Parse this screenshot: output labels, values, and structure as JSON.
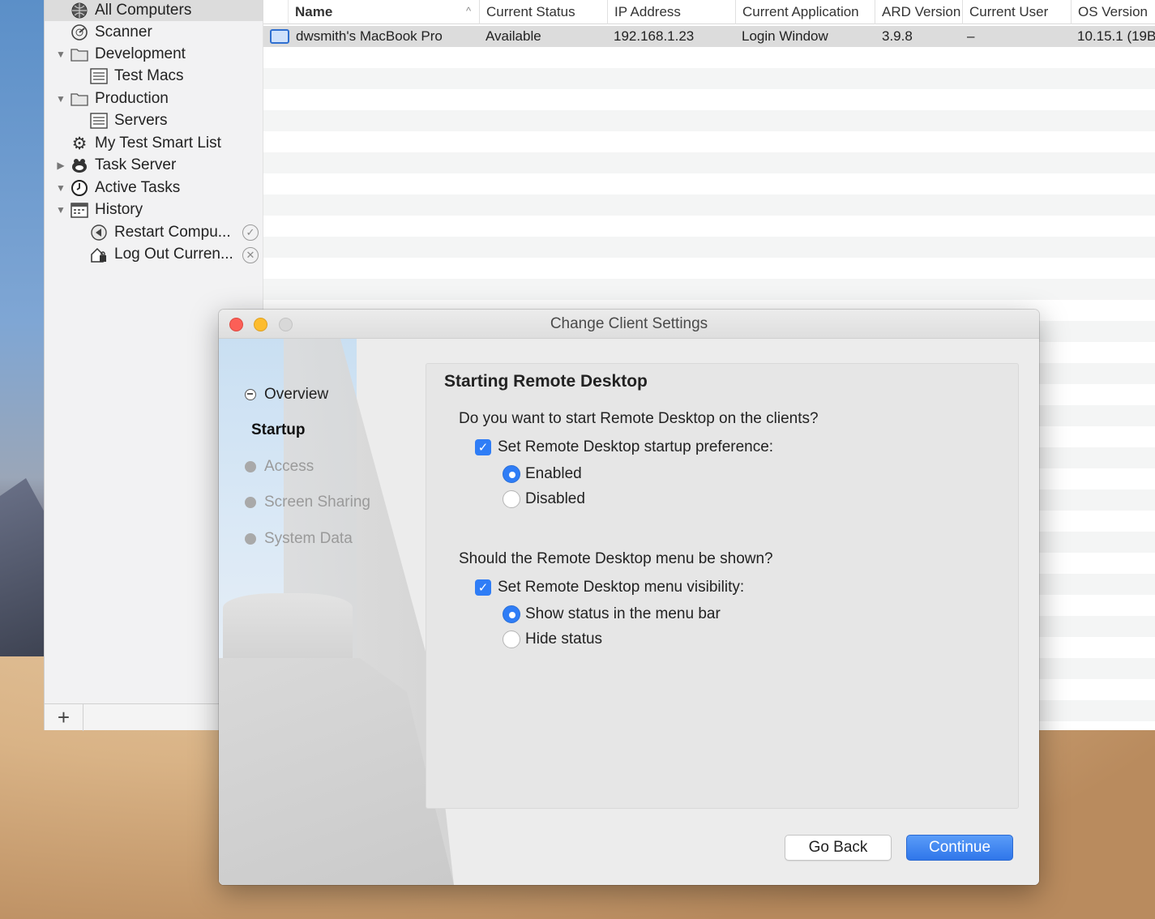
{
  "sidebar": {
    "items": [
      {
        "label": "All Computers",
        "icon": "globe-network-icon"
      },
      {
        "label": "Scanner",
        "icon": "scanner-icon"
      },
      {
        "label": "Development",
        "icon": "folder-icon"
      },
      {
        "label": "Test Macs",
        "icon": "list-icon"
      },
      {
        "label": "Production",
        "icon": "folder-icon"
      },
      {
        "label": "Servers",
        "icon": "list-icon"
      },
      {
        "label": "My Test Smart List",
        "icon": "gear-icon"
      },
      {
        "label": "Task Server",
        "icon": "task-server-icon"
      },
      {
        "label": "Active Tasks",
        "icon": "clock-icon"
      },
      {
        "label": "History",
        "icon": "calendar-icon"
      },
      {
        "label": "Restart Compu...",
        "icon": "restart-icon"
      },
      {
        "label": "Log Out Curren...",
        "icon": "logout-icon"
      }
    ],
    "add_label": "+"
  },
  "table": {
    "columns": [
      "Name",
      "Current Status",
      "IP Address",
      "Current Application",
      "ARD Version",
      "Current User",
      "OS Version"
    ],
    "rows": [
      {
        "name": "dwsmith's MacBook Pro",
        "status": "Available",
        "ip": "192.168.1.23",
        "application": "Login Window",
        "ard_version": "3.9.8",
        "user": "–",
        "os_version": "10.15.1 (19B"
      }
    ]
  },
  "dialog": {
    "title": "Change Client Settings",
    "steps": [
      "Overview",
      "Startup",
      "Access",
      "Screen Sharing",
      "System Data"
    ],
    "panel_title": "Starting Remote Desktop",
    "q1": "Do you want to start Remote Desktop on the clients?",
    "cb1": "Set Remote Desktop startup preference:",
    "r1_enabled": "Enabled",
    "r1_disabled": "Disabled",
    "q2": "Should the Remote Desktop menu be shown?",
    "cb2": "Set Remote Desktop menu visibility:",
    "r2_show": "Show status in the menu bar",
    "r2_hide": "Hide status",
    "back_label": "Go Back",
    "continue_label": "Continue"
  },
  "colors": {
    "accent": "#2f7df6",
    "close": "#fc5f57",
    "minimize": "#fdbc2e"
  }
}
